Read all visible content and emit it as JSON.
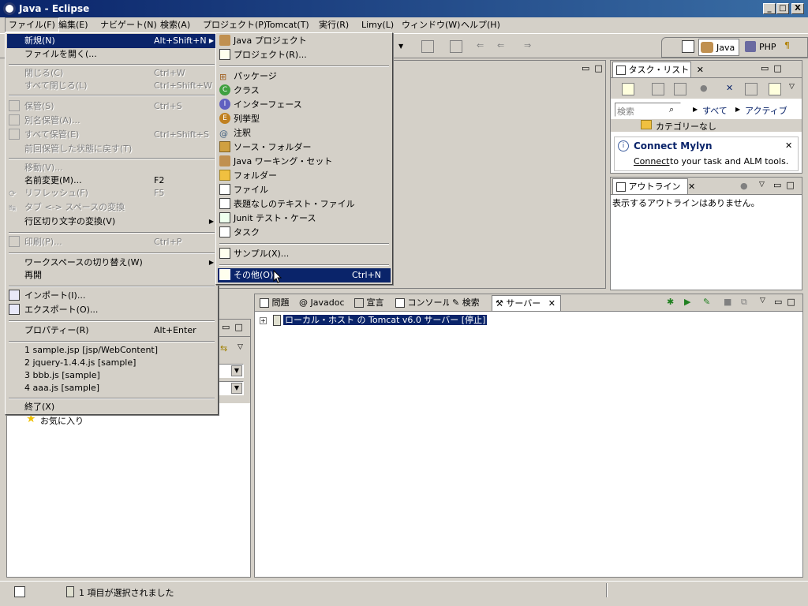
{
  "window": {
    "title": "Java - Eclipse",
    "min": "_",
    "max": "□",
    "close": "X"
  },
  "menubar": [
    "ファイル(F)",
    "編集(E)",
    "ナビゲート(N)",
    "検索(A)",
    "プロジェクト(P)",
    "Tomcat(T)",
    "実行(R)",
    "Limy(L)",
    "ウィンドウ(W)",
    "ヘルプ(H)"
  ],
  "perspectives": {
    "java": "Java",
    "php": "PHP"
  },
  "file_menu": [
    {
      "label": "新規(N)",
      "shortcut": "Alt+Shift+N",
      "arrow": "▶",
      "state": "highlight"
    },
    {
      "label": "ファイルを開く(...",
      "shortcut": "",
      "state": "normal"
    },
    {
      "label": "閉じる(C)",
      "shortcut": "Ctrl+W",
      "state": "disabled"
    },
    {
      "label": "すべて閉じる(L)",
      "shortcut": "Ctrl+Shift+W",
      "state": "disabled"
    },
    {
      "label": "保管(S)",
      "shortcut": "Ctrl+S",
      "state": "disabled"
    },
    {
      "label": "別名保管(A)...",
      "shortcut": "",
      "state": "disabled"
    },
    {
      "label": "すべて保管(E)",
      "shortcut": "Ctrl+Shift+S",
      "state": "disabled"
    },
    {
      "label": "前回保管した状態に戻す(T)",
      "shortcut": "",
      "state": "disabled"
    },
    {
      "label": "移動(V)...",
      "shortcut": "",
      "state": "disabled"
    },
    {
      "label": "名前変更(M)...",
      "shortcut": "F2",
      "state": "normal"
    },
    {
      "label": "リフレッシュ(F)",
      "shortcut": "F5",
      "state": "disabled"
    },
    {
      "label": "タブ <-> スペースの変換",
      "shortcut": "",
      "state": "disabled"
    },
    {
      "label": "行区切り文字の変換(V)",
      "shortcut": "",
      "arrow": "▶",
      "state": "normal"
    },
    {
      "label": "印刷(P)...",
      "shortcut": "Ctrl+P",
      "state": "disabled"
    },
    {
      "label": "ワークスペースの切り替え(W)",
      "shortcut": "",
      "arrow": "▶",
      "state": "normal"
    },
    {
      "label": "再開",
      "shortcut": "",
      "state": "normal"
    },
    {
      "label": "インポート(I)...",
      "shortcut": "",
      "state": "normal"
    },
    {
      "label": "エクスポート(O)...",
      "shortcut": "",
      "state": "normal"
    },
    {
      "label": "プロパティー(R)",
      "shortcut": "Alt+Enter",
      "state": "normal"
    },
    {
      "label": "1 sample.jsp  [jsp/WebContent]",
      "shortcut": "",
      "state": "normal"
    },
    {
      "label": "2 jquery-1.4.4.js  [sample]",
      "shortcut": "",
      "state": "normal"
    },
    {
      "label": "3 bbb.js  [sample]",
      "shortcut": "",
      "state": "normal"
    },
    {
      "label": "4 aaa.js  [sample]",
      "shortcut": "",
      "state": "normal"
    },
    {
      "label": "終了(X)",
      "shortcut": "",
      "state": "normal"
    }
  ],
  "new_submenu": [
    {
      "label": "Java プロジェクト",
      "shortcut": "",
      "state": "normal",
      "icon": "java-project-icon"
    },
    {
      "label": "プロジェクト(R)...",
      "shortcut": "",
      "state": "normal",
      "icon": "project-icon"
    },
    {
      "label": "パッケージ",
      "shortcut": "",
      "state": "normal",
      "icon": "package-icon"
    },
    {
      "label": "クラス",
      "shortcut": "",
      "state": "normal",
      "icon": "class-icon"
    },
    {
      "label": "インターフェース",
      "shortcut": "",
      "state": "normal",
      "icon": "interface-icon"
    },
    {
      "label": "列挙型",
      "shortcut": "",
      "state": "normal",
      "icon": "enum-icon"
    },
    {
      "label": "注釈",
      "shortcut": "",
      "state": "normal",
      "icon": "annotation-icon"
    },
    {
      "label": "ソース・フォルダー",
      "shortcut": "",
      "state": "normal",
      "icon": "source-folder-icon"
    },
    {
      "label": "Java ワーキング・セット",
      "shortcut": "",
      "state": "normal",
      "icon": "working-set-icon"
    },
    {
      "label": "フォルダー",
      "shortcut": "",
      "state": "normal",
      "icon": "folder-icon"
    },
    {
      "label": "ファイル",
      "shortcut": "",
      "state": "normal",
      "icon": "file-icon"
    },
    {
      "label": "表題なしのテキスト・ファイル",
      "shortcut": "",
      "state": "normal",
      "icon": "text-file-icon"
    },
    {
      "label": "Junit テスト・ケース",
      "shortcut": "",
      "state": "normal",
      "icon": "junit-icon"
    },
    {
      "label": "タスク",
      "shortcut": "",
      "state": "normal",
      "icon": "task-icon"
    },
    {
      "label": "サンプル(X)...",
      "shortcut": "",
      "state": "normal",
      "icon": "sample-icon"
    },
    {
      "label": "その他(O)...",
      "shortcut": "Ctrl+N",
      "state": "highlight",
      "icon": "other-icon"
    }
  ],
  "task_list": {
    "tab": "タスク・リスト",
    "search_placeholder": "検索",
    "all": "すべて",
    "active": "アクティブに...",
    "category": "カテゴリーなし",
    "mylyn_title": "Connect Mylyn",
    "mylyn_link": "Connect",
    "mylyn_rest": "to your task and ALM tools."
  },
  "outline": {
    "tab": "アウトライン",
    "empty": "表示するアウトラインはありません。"
  },
  "bottom_tabs": [
    "問題",
    "Javadoc",
    "宣言",
    "コンソール",
    "検索",
    "サーバー"
  ],
  "servers": {
    "item": "ローカル・ホスト の Tomcat v6.0 サーバー  [停止]"
  },
  "left_panel": {
    "favorites": "お気に入り"
  },
  "status": {
    "text": "1 項目が選択されました"
  }
}
